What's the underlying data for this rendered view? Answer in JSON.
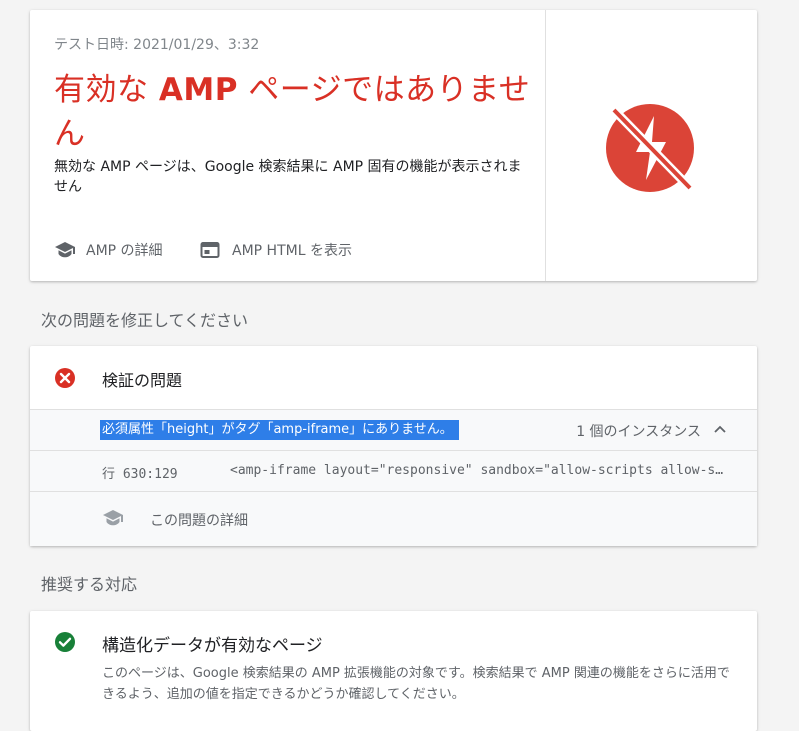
{
  "result": {
    "test_date": "テスト日時: 2021/01/29、3:32",
    "title_prefix": "有効な ",
    "title_amp": "AMP",
    "title_suffix": " ページではありません",
    "description": "無効な AMP ページは、Google 検索結果に AMP 固有の機能が表示されません",
    "links": {
      "amp_details": "AMP の詳細",
      "amp_html": "AMP HTML を表示"
    },
    "status_icon": "invalid-amp-icon",
    "status_color": "#db4437"
  },
  "fix_section": {
    "heading": "次の問題を修正してください",
    "issue_title": "検証の問題",
    "issue_message": "必須属性「height」がタグ「amp-iframe」にありません。",
    "instances": "1 個のインスタンス",
    "line_label": "行 630:129",
    "code": "<amp-iframe layout=\"responsive\" sandbox=\"allow-scripts allow-same-origin\">",
    "details_label": "この問題の詳細",
    "error_color": "#d93025",
    "highlight_color": "#2e7ee8"
  },
  "improve_section": {
    "heading": "推奨する対応",
    "title": "構造化データが有効なページ",
    "description": "このページは、Google 検索結果の AMP 拡張機能の対象です。検索結果で AMP 関連の機能をさらに活用できるよう、追加の値を指定できるかどうか確認してください。",
    "ok_color": "#188038"
  }
}
